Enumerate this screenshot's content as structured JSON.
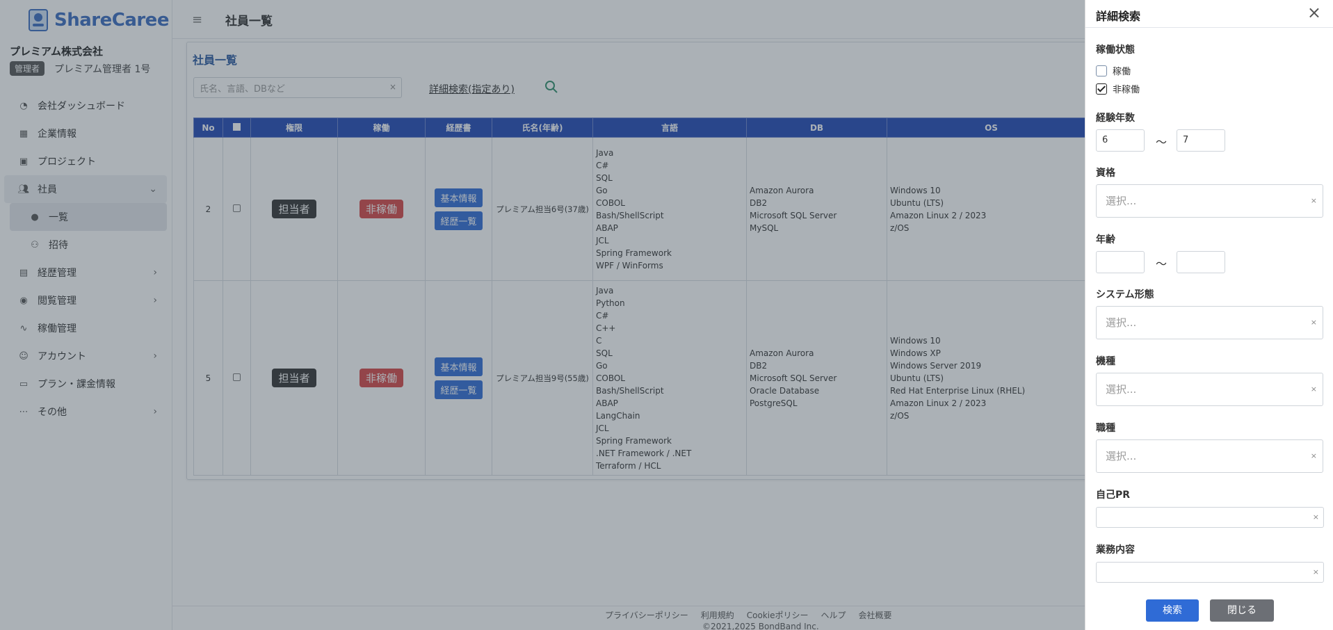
{
  "brand": {
    "logo_text": "ShareCaree",
    "accent": "#3a6bc0"
  },
  "sidebar": {
    "company": "プレミアム株式会社",
    "role_badge": "管理者",
    "user_name": "プレミアム管理者 1号",
    "items": [
      {
        "label": "会社ダッシュボード",
        "icon": "dashboard-icon"
      },
      {
        "label": "企業情報",
        "icon": "building-icon"
      },
      {
        "label": "プロジェクト",
        "icon": "project-icon"
      },
      {
        "label": "社員",
        "icon": "users-icon",
        "expanded": true
      },
      {
        "label": "一覧",
        "icon": "people-icon",
        "active": true
      },
      {
        "label": "招待",
        "icon": "user-plus-icon"
      },
      {
        "label": "経歴管理",
        "icon": "id-card-icon"
      },
      {
        "label": "閲覧管理",
        "icon": "eye-icon"
      },
      {
        "label": "稼働管理",
        "icon": "activity-icon"
      },
      {
        "label": "アカウント",
        "icon": "account-icon"
      },
      {
        "label": "プラン・課金情報",
        "icon": "billing-icon"
      },
      {
        "label": "その他",
        "icon": "more-icon"
      }
    ]
  },
  "topbar": {
    "title": "社員一覧"
  },
  "card": {
    "title": "社員一覧",
    "search_placeholder": "氏名、言語、DBなど",
    "search_clear": "×",
    "advanced_link": "詳細検索(指定あり)"
  },
  "table": {
    "headers": [
      "No",
      "",
      "権限",
      "稼働",
      "経歴書",
      "氏名(年齢)",
      "言語",
      "DB",
      "OS"
    ],
    "rows": [
      {
        "no": "2",
        "role": "担当者",
        "status": "非稼働",
        "btn_basic": "基本情報",
        "btn_history": "経歴一覧",
        "name": "プレミアム担当6号(37歳)",
        "languages": [
          "Java",
          "C#",
          "SQL",
          "Go",
          "COBOL",
          "Bash/ShellScript",
          "ABAP",
          "JCL",
          "Spring Framework",
          "WPF / WinForms"
        ],
        "db": [
          "Amazon Aurora",
          "DB2",
          "Microsoft SQL Server",
          "MySQL"
        ],
        "os": [
          "Windows 10",
          "Ubuntu (LTS)",
          "Amazon Linux 2 / 2023",
          "z/OS"
        ]
      },
      {
        "no": "5",
        "role": "担当者",
        "status": "非稼働",
        "btn_basic": "基本情報",
        "btn_history": "経歴一覧",
        "name": "プレミアム担当9号(55歳)",
        "languages": [
          "Java",
          "Python",
          "C#",
          "C++",
          "C",
          "SQL",
          "Go",
          "COBOL",
          "Bash/ShellScript",
          "ABAP",
          "LangChain",
          "JCL",
          "Spring Framework",
          ".NET Framework / .NET",
          "Terraform / HCL"
        ],
        "db": [
          "Amazon Aurora",
          "DB2",
          "Microsoft SQL Server",
          "Oracle Database",
          "PostgreSQL"
        ],
        "os": [
          "Windows 10",
          "Windows XP",
          "Windows Server 2019",
          "Ubuntu (LTS)",
          "Red Hat Enterprise Linux (RHEL)",
          "Amazon Linux 2 / 2023",
          "z/OS"
        ]
      }
    ]
  },
  "footer": {
    "links": [
      "プライバシーポリシー",
      "利用規約",
      "Cookieポリシー",
      "ヘルプ",
      "会社概要"
    ],
    "copyright": "©2021,2025 BondBand Inc."
  },
  "drawer": {
    "title": "詳細検索",
    "close": "×",
    "status_label": "稼働状態",
    "status_options": [
      {
        "label": "稼働",
        "checked": false
      },
      {
        "label": "非稼働",
        "checked": true
      }
    ],
    "experience_label": "経験年数",
    "experience_min": "6",
    "experience_max": "7",
    "range_sep": "〜",
    "qualification_label": "資格",
    "age_label": "年齢",
    "age_min": "",
    "age_max": "",
    "system_label": "システム形態",
    "machine_label": "機種",
    "job_label": "職種",
    "pr_label": "自己PR",
    "work_label": "業務内容",
    "select_placeholder": "選択...",
    "clear": "×",
    "search_button": "検索",
    "close_button": "閉じる",
    "primary_color": "#2f6bd6",
    "secondary_color": "#6c6f75"
  }
}
